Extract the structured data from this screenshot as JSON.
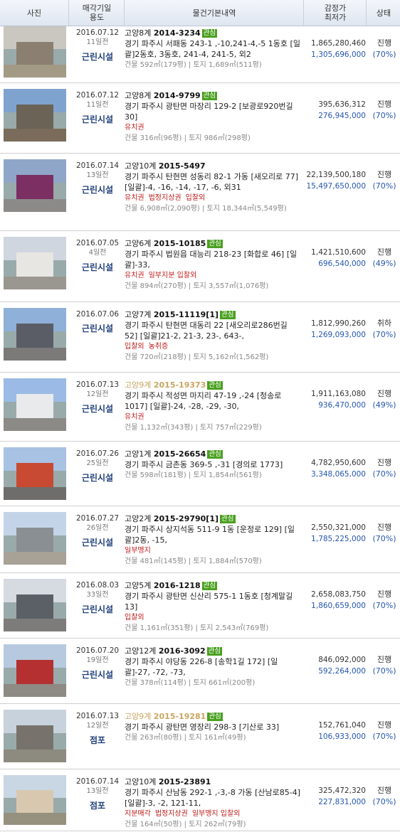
{
  "header": {
    "photo": "사진",
    "date_line1": "매각기일",
    "date_line2": "용도",
    "info": "물건기본내역",
    "price_line1": "감정가",
    "price_line2": "최저가",
    "status": "상태"
  },
  "rows": [
    {
      "date": "2016.07.12",
      "ago": "11일전",
      "use": "근린시설",
      "court": "고양8계",
      "case_no": "2014-3234",
      "badge": "관심",
      "addr": "경기 파주시 서패동 243-1 ,-10,241-4,-5 1동호 [일괄]2동호, 3동호, 241-4, 241-5, 외2",
      "tags": [],
      "size": "건물 592㎡(179평) | 토지 1,689㎡(511평)",
      "appraisal": "1,865,280,460",
      "minimum": "1,305,696,000",
      "status": "진행",
      "pct": "(70%)"
    },
    {
      "date": "2016.07.12",
      "ago": "11일전",
      "use": "근린시설",
      "court": "고양8계",
      "case_no": "2014-9799",
      "badge": "관심",
      "addr": "경기 파주시 광탄면 마장리 129-2 [보광로920번길 30]",
      "tags": [
        "유치권"
      ],
      "size": "건물 316㎡(96평) | 토지 986㎡(298평)",
      "appraisal": "395,636,312",
      "minimum": "276,945,000",
      "status": "진행",
      "pct": "(70%)"
    },
    {
      "date": "2016.07.14",
      "ago": "13일전",
      "use": "근린시설",
      "court": "고양10계",
      "case_no": "2015-5497",
      "badge": "",
      "addr": "경기 파주시 탄현면 성동리 82-1 가동 [새오리로 77] [일괄]-4, -16, -14, -17, -6, 외31",
      "tags": [
        "유치권",
        "법정지상권",
        "입찰외"
      ],
      "size": "건물 6,908㎡(2,090평) | 토지 18,344㎡(5,549평)",
      "appraisal": "22,139,500,180",
      "minimum": "15,497,650,000",
      "status": "진행",
      "pct": "(70%)"
    },
    {
      "date": "2016.07.05",
      "ago": "4일전",
      "use": "근린시설",
      "court": "고양6계",
      "case_no": "2015-10185",
      "badge": "관심",
      "addr": "경기 파주시 법원읍 대능리 218-23 [화합로 46] [일괄]-33,",
      "tags": [
        "유치권",
        "일부지분 입찰외"
      ],
      "size": "건물 894㎡(270평) | 토지 3,557㎡(1,076평)",
      "appraisal": "1,421,510,600",
      "minimum": "696,540,000",
      "status": "진행",
      "pct": "(49%)"
    },
    {
      "date": "2016.07.06",
      "ago": "",
      "use": "근린시설",
      "court": "고양7계",
      "case_no": "2015-11119[1]",
      "badge": "관심",
      "addr": "경기 파주시 탄현면 대동리 22 [새오리로286번길 52] [일괄]21-2, 21-3, 23-, 643-,",
      "tags": [
        "입찰외",
        "농취증"
      ],
      "size": "건물 720㎡(218평) | 토지 5,162㎡(1,562평)",
      "appraisal": "1,812,990,260",
      "minimum": "1,269,093,000",
      "status": "취하",
      "pct": "(70%)"
    },
    {
      "date": "2016.07.13",
      "ago": "12일전",
      "use": "근린시설",
      "court": "고양9계",
      "case_no": "2015-19373",
      "badge": "관심",
      "gold": true,
      "addr": "경기 파주시 적성면 마지리 47-19 ,-24 [청송로1017] [일괄]-24, -28, -29, -30,",
      "tags": [
        "유치권"
      ],
      "size": "건물 1,132㎡(343평) | 토지 757㎡(229평)",
      "appraisal": "1,911,163,080",
      "minimum": "936,470,000",
      "status": "진행",
      "pct": "(49%)"
    },
    {
      "date": "2016.07.26",
      "ago": "25일전",
      "use": "근린시설",
      "court": "고양1계",
      "case_no": "2015-26654",
      "badge": "관심",
      "addr": "경기 파주시 금촌동 369-5 ,-31 [경의로 1773]",
      "tags": [],
      "size": "건물 598㎡(181평) | 토지 1,854㎡(561평)",
      "appraisal": "4,782,950,600",
      "minimum": "3,348,065,000",
      "status": "진행",
      "pct": "(70%)"
    },
    {
      "date": "2016.07.27",
      "ago": "26일전",
      "use": "근린시설",
      "court": "고양2계",
      "case_no": "2015-29790[1]",
      "badge": "관심",
      "addr": "경기 파주시 상지석동 511-9 1동 [운정로 129] [일괄]2동, -15,",
      "tags": [
        "일부맹지"
      ],
      "size": "건물 481㎡(145평) | 토지 1,884㎡(570평)",
      "appraisal": "2,550,321,000",
      "minimum": "1,785,225,000",
      "status": "진행",
      "pct": "(70%)"
    },
    {
      "date": "2016.08.03",
      "ago": "33일전",
      "use": "근린시설",
      "court": "고양5계",
      "case_no": "2016-1218",
      "badge": "관심",
      "addr": "경기 파주시 광탄면 신산리 575-1 1동호 [청계말길 13]",
      "tags": [
        "입찰외"
      ],
      "size": "건물 1,161㎡(351평) | 토지 2,543㎡(769평)",
      "appraisal": "2,658,083,750",
      "minimum": "1,860,659,000",
      "status": "진행",
      "pct": "(70%)"
    },
    {
      "date": "2016.07.20",
      "ago": "19일전",
      "use": "근린시설",
      "court": "고양12계",
      "case_no": "2016-3092",
      "badge": "관심",
      "addr": "경기 파주시 야당동 226-8 [송학1길 172] [일괄]-27, -72, -73,",
      "tags": [],
      "size": "건물 378㎡(114평) | 토지 661㎡(200평)",
      "appraisal": "846,092,000",
      "minimum": "592,264,000",
      "status": "진행",
      "pct": "(70%)"
    },
    {
      "date": "2016.07.13",
      "ago": "12일전",
      "use": "점포",
      "court": "고양9계",
      "case_no": "2015-19281",
      "badge": "관심",
      "gold": true,
      "addr": "경기 파주시 광탄면 영장리 298-3 [기산로 33]",
      "tags": [],
      "size": "건물 263㎡(80평) | 토지 161㎡(49평)",
      "appraisal": "152,761,040",
      "minimum": "106,933,000",
      "status": "진행",
      "pct": "(70%)"
    },
    {
      "date": "2016.07.14",
      "ago": "13일전",
      "use": "점포",
      "court": "고양10계",
      "case_no": "2015-23891",
      "badge": "",
      "addr": "경기 파주시 산남동 292-1 ,-3,-8 가동 [산남로85-4] [일괄]-3, -2, 121-11,",
      "tags": [
        "지분매각",
        "법정지상권",
        "일부맹지 입찰외"
      ],
      "size": "건물 164㎡(50평) | 토지 262㎡(79평)",
      "appraisal": "325,472,320",
      "minimum": "227,831,000",
      "status": "진행",
      "pct": "(70%)"
    }
  ]
}
